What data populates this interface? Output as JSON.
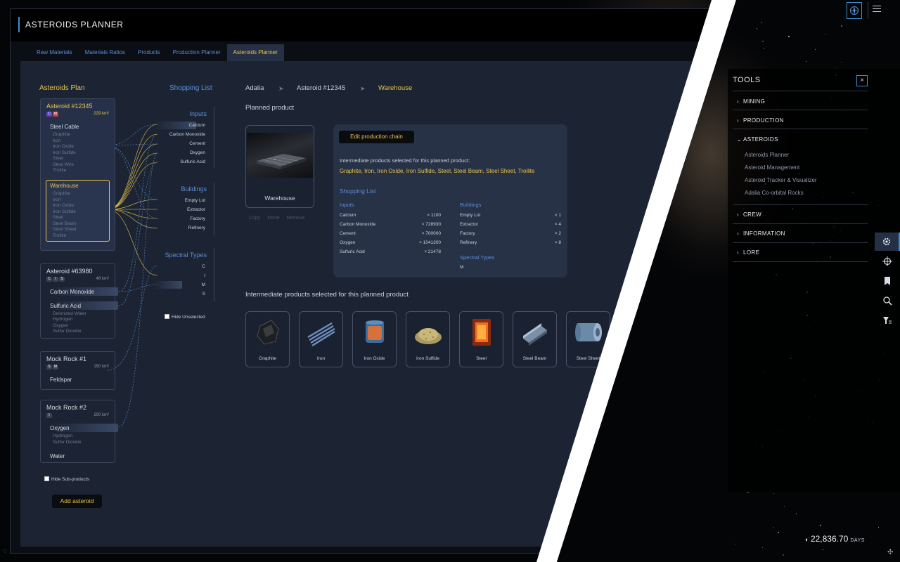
{
  "app": {
    "title": "ASTEROIDS PLANNER"
  },
  "tabs": [
    {
      "label": "Raw Materials"
    },
    {
      "label": "Materials Ratios"
    },
    {
      "label": "Products"
    },
    {
      "label": "Production Planner"
    },
    {
      "label": "Asteroids Planner",
      "active": true
    }
  ],
  "plan": {
    "heading": "Asteroids Plan",
    "asteroids": [
      {
        "name": "Asteroid #12345",
        "size": "229 km²",
        "tags": [
          "C",
          "M"
        ],
        "products": [
          {
            "name": "Steel Cable",
            "subs": [
              "Graphite",
              "Iron",
              "Iron Oxide",
              "Iron Sulfide",
              "Steel",
              "Steel Wire",
              "Troilite"
            ]
          },
          {
            "name": "Warehouse",
            "subs": [
              "Graphite",
              "Iron",
              "Iron Oxide",
              "Iron Sulfide",
              "Steel",
              "Steel Beam",
              "Steel Sheet",
              "Troilite"
            ]
          }
        ]
      },
      {
        "name": "Asteroid #63980",
        "size": "48 km²",
        "tags": [
          "C",
          "I",
          "S"
        ],
        "products": [
          {
            "name": "Carbon Monoxide",
            "subs": []
          },
          {
            "name": "Sulfuric Acid",
            "subs": [
              "Deionized Water",
              "Hydrogen",
              "Oxygen",
              "Sulfur Dioxide"
            ]
          }
        ]
      },
      {
        "name": "Mock Rock #1",
        "size": "150 km²",
        "tags": [
          "S",
          "M"
        ],
        "products": [
          {
            "name": "Feldspar",
            "subs": []
          }
        ]
      },
      {
        "name": "Mock Rock #2",
        "size": "200 km²",
        "tags": [
          "I"
        ],
        "products": [
          {
            "name": "Oxygen",
            "subs": [
              "Hydrogen",
              "Sulfur Dioxide"
            ]
          },
          {
            "name": "Water",
            "subs": []
          }
        ]
      }
    ],
    "hide_sub_products": "Hide Sub-products",
    "add_asteroid": "Add asteroid"
  },
  "shopping_list": {
    "heading": "Shopping List",
    "inputs": {
      "label": "Inputs",
      "items": [
        "Calcium",
        "Carbon Monoxide",
        "Cement",
        "Oxygen",
        "Sulfuric Acid"
      ]
    },
    "buildings": {
      "label": "Buildings",
      "items": [
        "Empty Lot",
        "Extractor",
        "Factory",
        "Refinery"
      ]
    },
    "spectral": {
      "label": "Spectral Types",
      "items": [
        "C",
        "I",
        "M",
        "S"
      ]
    },
    "hide_unselected": "Hide Unselected"
  },
  "breadcrumb": {
    "a": "Adalia",
    "b": "Asteroid #12345",
    "c": "Warehouse",
    "sep": "➤"
  },
  "planned": {
    "label": "Planned product",
    "product_name": "Warehouse",
    "actions": [
      "Copy",
      "Move",
      "Remove"
    ]
  },
  "detail": {
    "edit_button": "Edit production chain",
    "intermediate_label": "Intermediate products selected for this planned product:",
    "intermediate_list": "Graphite, Iron, Iron Oxide, Iron Sulfide, Steel, Steel Beam, Steel Sheet, Troilite",
    "shopping_list_heading": "Shopping List",
    "inputs_heading": "Inputs",
    "inputs": [
      {
        "name": "Calcium",
        "qty": "× 1100"
      },
      {
        "name": "Carbon Monoxide",
        "qty": "× 728930"
      },
      {
        "name": "Cement",
        "qty": "× 700000"
      },
      {
        "name": "Oxygen",
        "qty": "× 1041300"
      },
      {
        "name": "Sulfuric Acid",
        "qty": "× 21478"
      }
    ],
    "buildings_heading": "Buildings",
    "buildings": [
      {
        "name": "Empty Lot",
        "qty": "× 1"
      },
      {
        "name": "Extractor",
        "qty": "× 4"
      },
      {
        "name": "Factory",
        "qty": "× 2"
      },
      {
        "name": "Refinery",
        "qty": "× 8"
      }
    ],
    "spectral_heading": "Spectral Types",
    "spectral_value": "M"
  },
  "intermediate": {
    "heading": "Intermediate products selected for this planned product",
    "items": [
      "Graphite",
      "Iron",
      "Iron Oxide",
      "Iron Sulfide",
      "Steel",
      "Steel Beam",
      "Steel Sheet"
    ]
  },
  "tools": {
    "title": "TOOLS",
    "close": "×",
    "categories": [
      {
        "label": "MINING",
        "expanded": false
      },
      {
        "label": "PRODUCTION",
        "expanded": false
      },
      {
        "label": "ASTEROIDS",
        "expanded": true
      },
      {
        "label": "CREW",
        "expanded": false
      },
      {
        "label": "INFORMATION",
        "expanded": false
      },
      {
        "label": "LORE",
        "expanded": false
      }
    ],
    "asteroid_links": [
      "Asteroids Planner",
      "Asteroid Management",
      "Asteroid Tracker & Visualizer",
      "Adalia Co-orbital Rocks"
    ]
  },
  "clock": {
    "value": "22,836.70",
    "unit": "DAYS"
  },
  "colors": {
    "accent_gold": "#e8c34a",
    "accent_blue": "#5a8fd8",
    "panel": "#1c2433",
    "frame_blue": "#3a8ed8"
  },
  "icons": [
    "compass-icon",
    "menu-icon",
    "gear-icon",
    "crosshair-icon",
    "bookmark-icon",
    "search-zoom-icon",
    "filter-list-icon",
    "chevron-right-icon",
    "chevron-down-icon",
    "close-icon",
    "clock-icon",
    "expand-icon"
  ]
}
